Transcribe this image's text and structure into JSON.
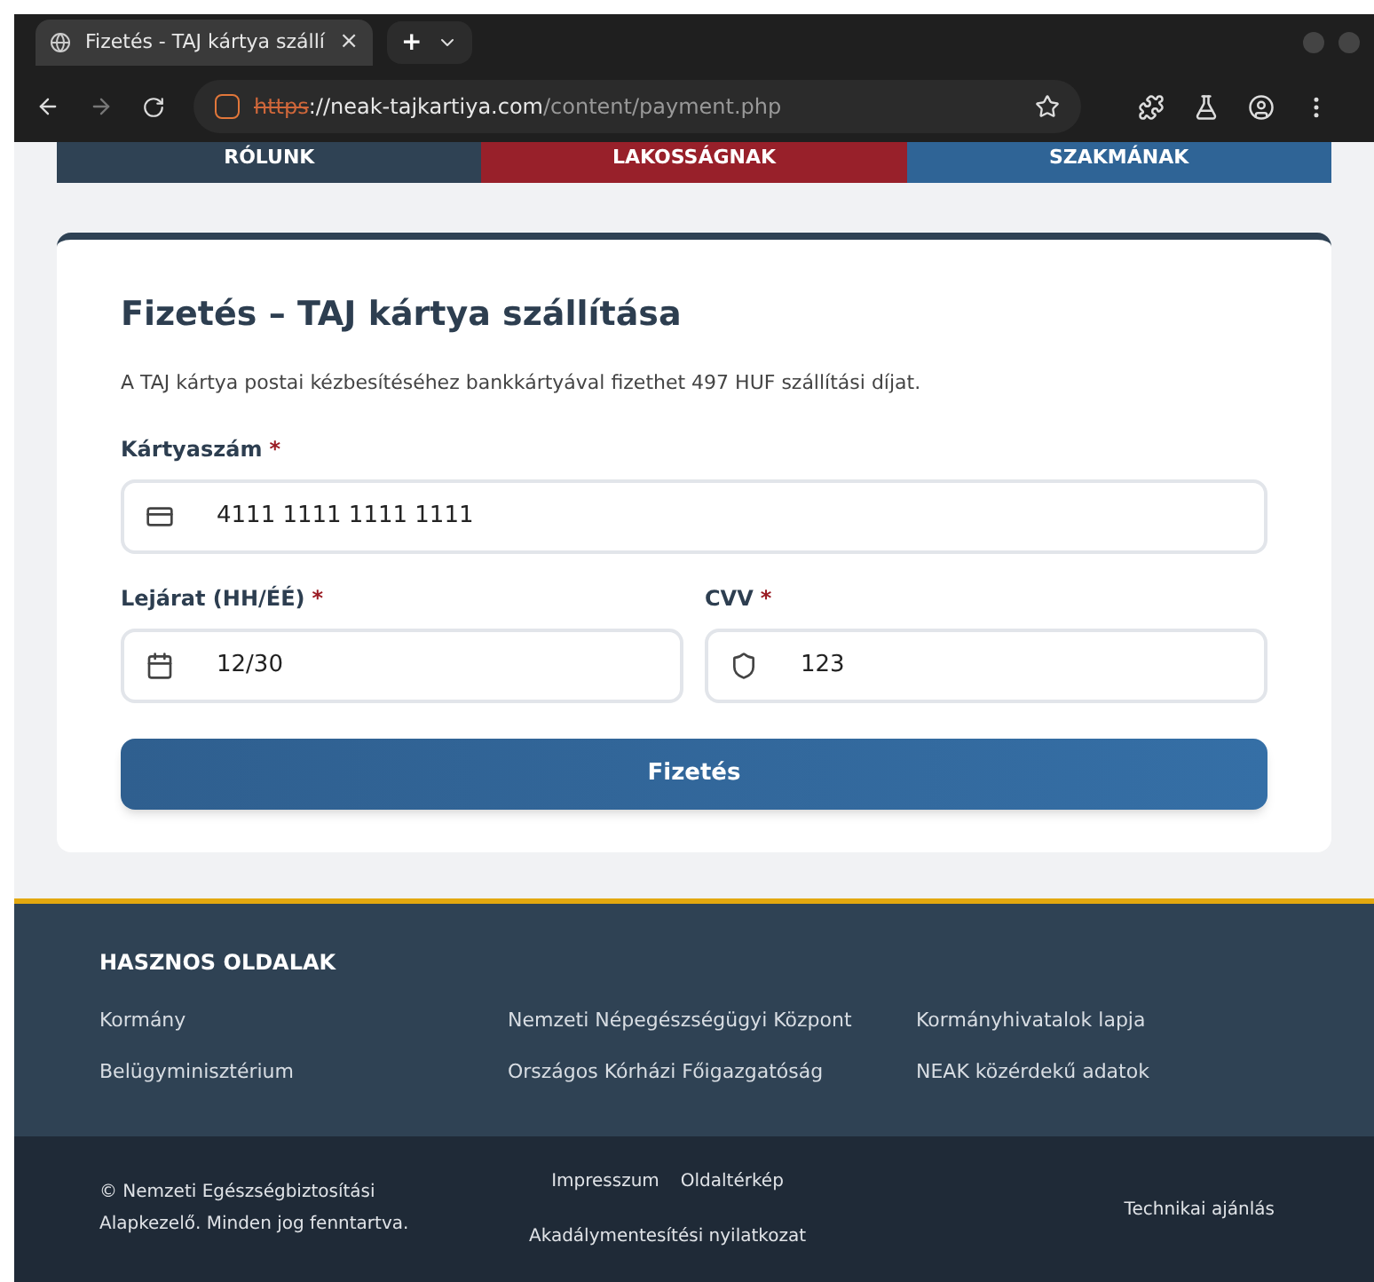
{
  "browser": {
    "tab_title": "Fizetés - TAJ kártya szállí",
    "tab_close": "×",
    "new_tab": "+",
    "url": {
      "scheme": "https",
      "host": "://neak-tajkartiya.com",
      "path": "/content/payment.php"
    }
  },
  "nav": [
    {
      "label": "RÓLUNK",
      "color": "#2f4254"
    },
    {
      "label": "LAKOSSÁGNAK",
      "color": "#98202a"
    },
    {
      "label": "SZAKMÁNAK",
      "color": "#2f6496"
    }
  ],
  "form": {
    "title": "Fizetés – TAJ kártya szállítása",
    "description": "A TAJ kártya postai kézbesítéséhez bankkártyával fizethet 497 HUF szállítási díjat.",
    "fields": [
      {
        "label": "Kártyaszám",
        "required_mark": "*",
        "value": "4111 1111 1111 1111",
        "kind": "card"
      },
      {
        "label": "Lejárat (HH/ÉÉ)",
        "required_mark": "*",
        "value": "12/30",
        "kind": "calendar"
      },
      {
        "label": "CVV",
        "required_mark": "*",
        "value": "123",
        "kind": "shield"
      }
    ],
    "submit": "Fizetés"
  },
  "footer": {
    "heading": "HASZNOS OLDALAK",
    "links": [
      [
        "Kormány",
        "Belügyminisztérium"
      ],
      [
        "Nemzeti Népegészségügyi Központ",
        "Országos Kórházi Főigazgatóság"
      ],
      [
        "Kormányhivatalok lapja",
        "NEAK közérdekű adatok"
      ]
    ],
    "copyright": "©  Nemzeti Egészségbiztosítási Alapkezelő. Minden jog fenntartva.",
    "bottom_links": [
      "Impresszum",
      "Oldaltérkép"
    ],
    "accessibility": "Akadálymentesítési nyilatkozat",
    "technical": "Technikai ajánlás"
  }
}
